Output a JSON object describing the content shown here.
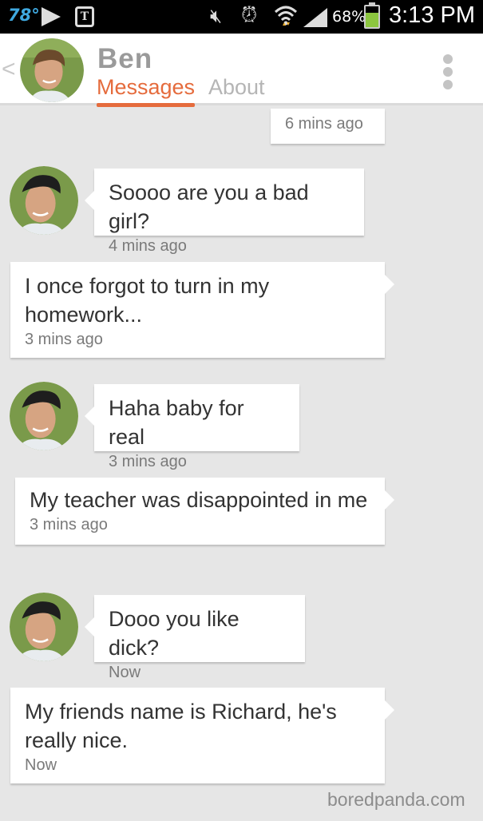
{
  "status_bar": {
    "temperature": "78°",
    "battery_percent": "68%",
    "battery_level": 0.68,
    "time": "3:13 PM",
    "icons": [
      "play-icon",
      "t-mobile-icon",
      "mute-icon",
      "alarm-icon",
      "wifi-icon",
      "signal-icon",
      "battery-icon"
    ]
  },
  "header": {
    "contact_name": "Ben",
    "tabs": [
      {
        "label": "Messages",
        "active": true
      },
      {
        "label": "About",
        "active": false
      }
    ],
    "colors": {
      "accent": "#e56b3c",
      "inactive": "#b5b5b5"
    }
  },
  "messages": [
    {
      "sender": "me",
      "text": "",
      "time": "6 mins ago"
    },
    {
      "sender": "Ben",
      "text": "Soooo are you a bad girl?",
      "time": "4 mins ago"
    },
    {
      "sender": "me",
      "text": "I once forgot to turn in my homework...",
      "time": "3 mins ago"
    },
    {
      "sender": "Ben",
      "text": "Haha baby for real",
      "time": "3 mins ago"
    },
    {
      "sender": "me",
      "text": "My teacher was disappointed in me",
      "time": "3 mins ago"
    },
    {
      "sender": "Ben",
      "text": "Dooo you like dick?",
      "time": "Now"
    },
    {
      "sender": "me",
      "text": "My friends name is Richard, he's really nice.",
      "time": "Now"
    }
  ],
  "watermark": "boredpanda.com"
}
